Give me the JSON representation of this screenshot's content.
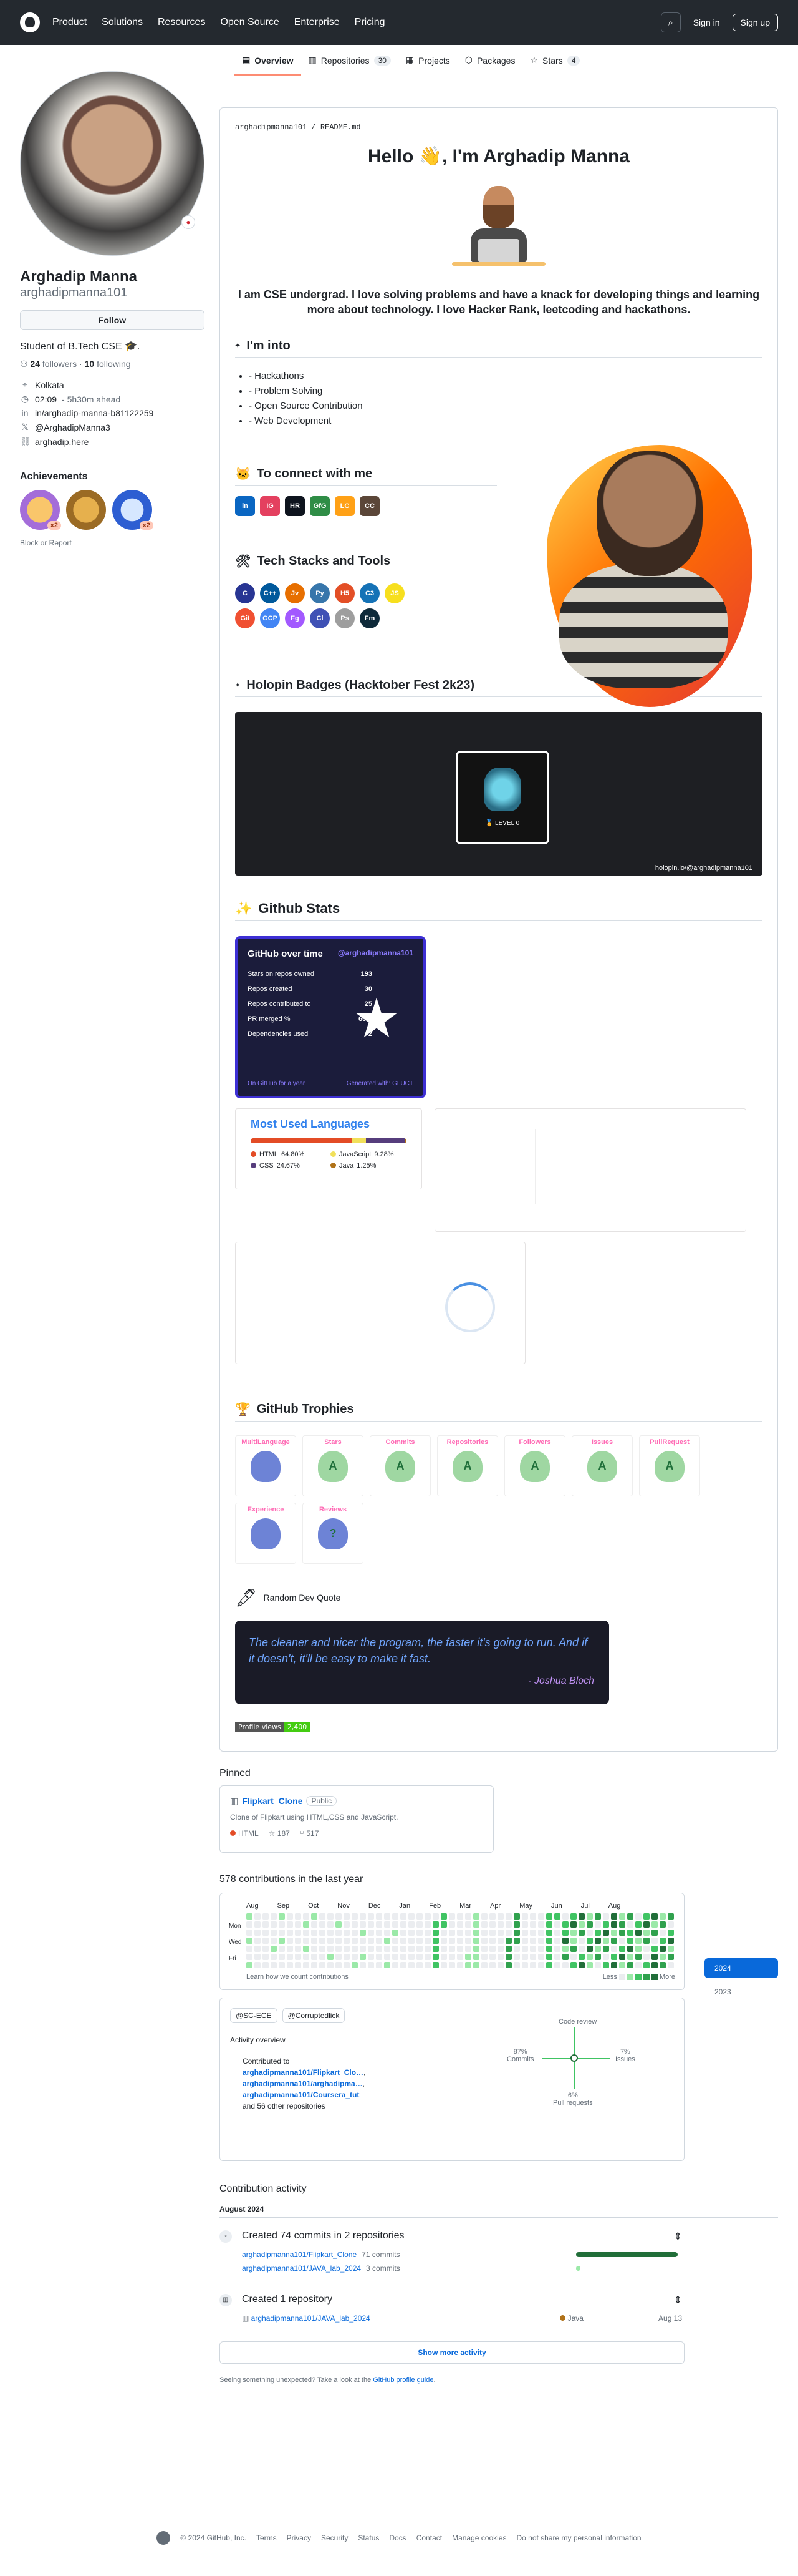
{
  "nav": {
    "items": [
      "Product",
      "Solutions",
      "Resources",
      "Open Source",
      "Enterprise",
      "Pricing"
    ],
    "signin": "Sign in",
    "signup": "Sign up"
  },
  "tabs": [
    {
      "label": "Overview",
      "count": ""
    },
    {
      "label": "Repositories",
      "count": "30"
    },
    {
      "label": "Projects",
      "count": ""
    },
    {
      "label": "Packages",
      "count": ""
    },
    {
      "label": "Stars",
      "count": "4"
    }
  ],
  "profile": {
    "name": "Arghadip Manna",
    "login": "arghadipmanna101",
    "follow": "Follow",
    "bio": "Student of B.Tech CSE 🎓.",
    "followers": "24",
    "followers_label": "followers",
    "following": "10",
    "following_label": "following",
    "location": "Kolkata",
    "time": "02:09",
    "time_ahead": "- 5h30m ahead",
    "linkedin": "in/arghadip-manna-b81122259",
    "twitter": "@ArghadipManna3",
    "website": "arghadip.here",
    "achievements_title": "Achievements",
    "block": "Block or Report",
    "badge_counts": [
      "x2",
      "",
      "x2"
    ]
  },
  "readme": {
    "path": "arghadipmanna101 / README.md",
    "hello": "Hello 👋, I'm Arghadip Manna",
    "bio": "I am CSE undergrad. I love solving problems and have a knack for developing things and learning more about technology. I love Hacker Rank, leetcoding and hackathons.",
    "into_title": "I'm into",
    "into": [
      "- Hackathons",
      "- Problem Solving",
      "- Open Source Contribution",
      "- Web Development"
    ],
    "connect_title": "To connect with me",
    "connect_icons": [
      {
        "label": "in",
        "color": "#0a66c2"
      },
      {
        "label": "IG",
        "color": "#e4405f"
      },
      {
        "label": "HR",
        "color": "#0e141e"
      },
      {
        "label": "GfG",
        "color": "#2f8d46"
      },
      {
        "label": "LC",
        "color": "#ffa116"
      },
      {
        "label": "CC",
        "color": "#5b4638"
      }
    ],
    "tech_title": "Tech Stacks and Tools",
    "tech_icons": [
      {
        "label": "C",
        "color": "#283593"
      },
      {
        "label": "C++",
        "color": "#00599c"
      },
      {
        "label": "Jv",
        "color": "#e76f00"
      },
      {
        "label": "Py",
        "color": "#3776ab"
      },
      {
        "label": "H5",
        "color": "#e34f26"
      },
      {
        "label": "C3",
        "color": "#1572b6"
      },
      {
        "label": "JS",
        "color": "#f7df1e"
      },
      {
        "label": "Git",
        "color": "#f05032"
      },
      {
        "label": "GCP",
        "color": "#4285f4"
      },
      {
        "label": "Fg",
        "color": "#a259ff"
      },
      {
        "label": "Cl",
        "color": "#3f51b5"
      },
      {
        "label": "Ps",
        "color": "#9e9e9e"
      },
      {
        "label": "Fm",
        "color": "#0e2a3a"
      }
    ],
    "holopin_title": "Holopin Badges (Hacktober Fest 2k23)",
    "holopin_level": "🏅 LEVEL 0",
    "holopin_footer": "holopin.io/@arghadipmanna101",
    "stats_title": "Github Stats",
    "gh_card_title": "GitHub over time",
    "gh_card_handle": "@arghadipmanna101",
    "gh_stats": [
      {
        "label": "Stars on repos owned",
        "value": "193"
      },
      {
        "label": "Repos created",
        "value": "30"
      },
      {
        "label": "Repos contributed to",
        "value": "25"
      },
      {
        "label": "PR merged %",
        "value": "66%"
      },
      {
        "label": "Dependencies used",
        "value": "2"
      }
    ],
    "gh_card_foot_left": "On GitHub for a year",
    "gh_card_foot_right": "Generated with: GLUCT",
    "lang_title": "Most Used Languages",
    "langs": [
      {
        "name": "HTML",
        "pct": "64.80%",
        "value": 64.8,
        "color": "#e34c26"
      },
      {
        "name": "JavaScript",
        "pct": "9.28%",
        "value": 9.28,
        "color": "#f1e05a"
      },
      {
        "name": "CSS",
        "pct": "24.67%",
        "value": 24.67,
        "color": "#563d7c"
      },
      {
        "name": "Java",
        "pct": "1.25%",
        "value": 1.25,
        "color": "#b07219"
      }
    ],
    "trophies_title": "GitHub Trophies",
    "trophies": [
      {
        "title": "MultiLanguage",
        "rank": "",
        "color": "#6d83d6"
      },
      {
        "title": "Stars",
        "rank": "A",
        "color": "#9fd7a2"
      },
      {
        "title": "Commits",
        "rank": "A",
        "color": "#9fd7a2"
      },
      {
        "title": "Repositories",
        "rank": "A",
        "color": "#9fd7a2"
      },
      {
        "title": "Followers",
        "rank": "A",
        "color": "#9fd7a2"
      },
      {
        "title": "Issues",
        "rank": "A",
        "color": "#9fd7a2"
      },
      {
        "title": "PullRequest",
        "rank": "A",
        "color": "#9fd7a2"
      },
      {
        "title": "Experience",
        "rank": "",
        "color": "#6d83d6"
      },
      {
        "title": "Reviews",
        "rank": "?",
        "color": "#6d83d6"
      }
    ],
    "quote_title": "Random Dev Quote",
    "quote": "The cleaner and nicer the program, the faster it's going to run. And if it doesn't, it'll be easy to make it fast.",
    "quote_author": "- Joshua Bloch",
    "views_label": "Profile views",
    "views_value": "2,400"
  },
  "pinned": {
    "title": "Pinned",
    "repo": "Flipkart_Clone",
    "visibility": "Public",
    "desc": "Clone of Flipkart using HTML,CSS and JavaScript.",
    "lang": "HTML",
    "lang_color": "#e34c26",
    "stars": "187",
    "forks": "517"
  },
  "contrib": {
    "title": "578 contributions in the last year",
    "months": [
      "Aug",
      "Sep",
      "Oct",
      "Nov",
      "Dec",
      "Jan",
      "Feb",
      "Mar",
      "Apr",
      "May",
      "Jun",
      "Jul",
      "Aug"
    ],
    "days": [
      "Mon",
      "Wed",
      "Fri"
    ],
    "learn": "Learn how we count contributions",
    "less": "Less",
    "more": "More",
    "years": [
      "2024",
      "2023"
    ],
    "orgs": [
      "@SC-ECE",
      "@Corruptedlick"
    ],
    "overview_title": "Activity overview",
    "contributed_to": "Contributed to",
    "repos": [
      "arghadipmanna101/Flipkart_Clo…",
      "arghadipmanna101/arghadipma…",
      "arghadipmanna101/Coursera_tut"
    ],
    "and_more": "and 56 other repositories",
    "radar": {
      "code_review": "Code review",
      "commits": "87%",
      "commits_label": "Commits",
      "issues": "7%",
      "issues_label": "Issues",
      "prs": "6%",
      "prs_label": "Pull requests"
    }
  },
  "activity": {
    "title": "Contribution activity",
    "month": "August 2024",
    "event1": "Created 74 commits in 2 repositories",
    "event1_repos": [
      {
        "name": "arghadipmanna101/Flipkart_Clone",
        "count": "71 commits",
        "share": 0.96
      },
      {
        "name": "arghadipmanna101/JAVA_lab_2024",
        "count": "3 commits",
        "share": 0.04
      }
    ],
    "event2": "Created 1 repository",
    "event2_repo": "arghadipmanna101/JAVA_lab_2024",
    "event2_lang": "Java",
    "event2_date": "Aug 13",
    "show_more": "Show more activity",
    "unexpected": "Seeing something unexpected? Take a look at the",
    "guide": "GitHub profile guide",
    "guide_end": "."
  },
  "footer": {
    "copyright": "© 2024 GitHub, Inc.",
    "links": [
      "Terms",
      "Privacy",
      "Security",
      "Status",
      "Docs",
      "Contact",
      "Manage cookies",
      "Do not share my personal information"
    ]
  }
}
